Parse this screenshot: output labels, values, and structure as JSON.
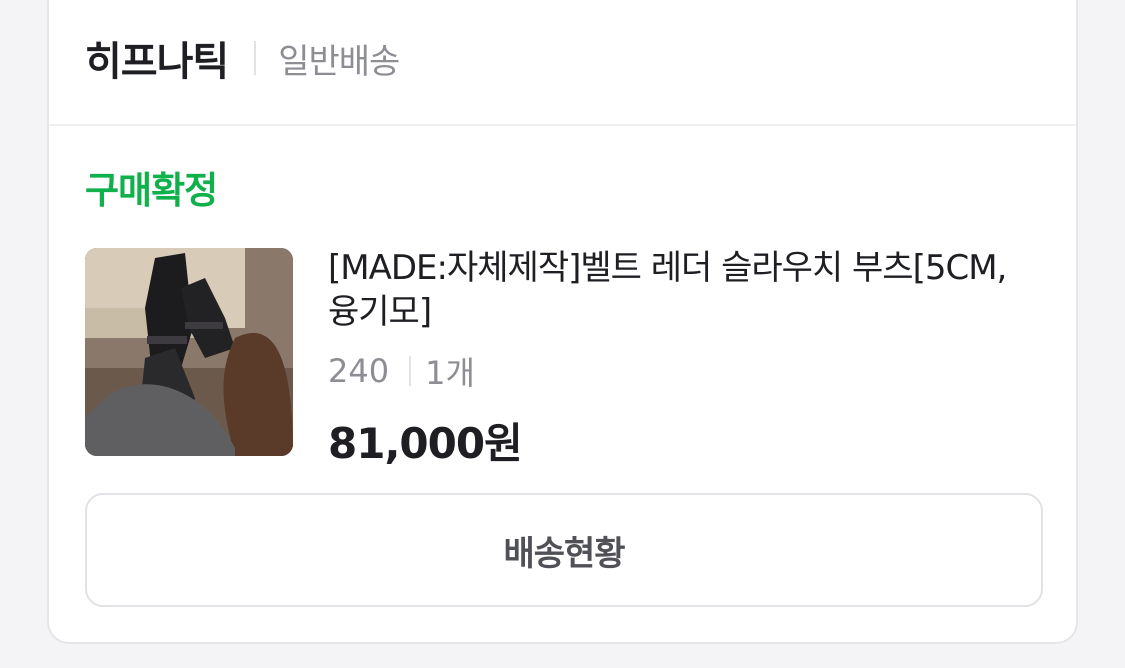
{
  "order": {
    "seller_name": "히프나틱",
    "shipping_type": "일반배송",
    "status": "구매확정",
    "status_color": "#10b04b",
    "product": {
      "name": "[MADE:자체제작]벨트 레더 슬라우치 부츠[5CM,융기모]",
      "option_size": "240",
      "option_qty": "1개",
      "price": "81,000원",
      "image_icon": "product-thumbnail-boots"
    },
    "track_button_label": "배송현황"
  }
}
